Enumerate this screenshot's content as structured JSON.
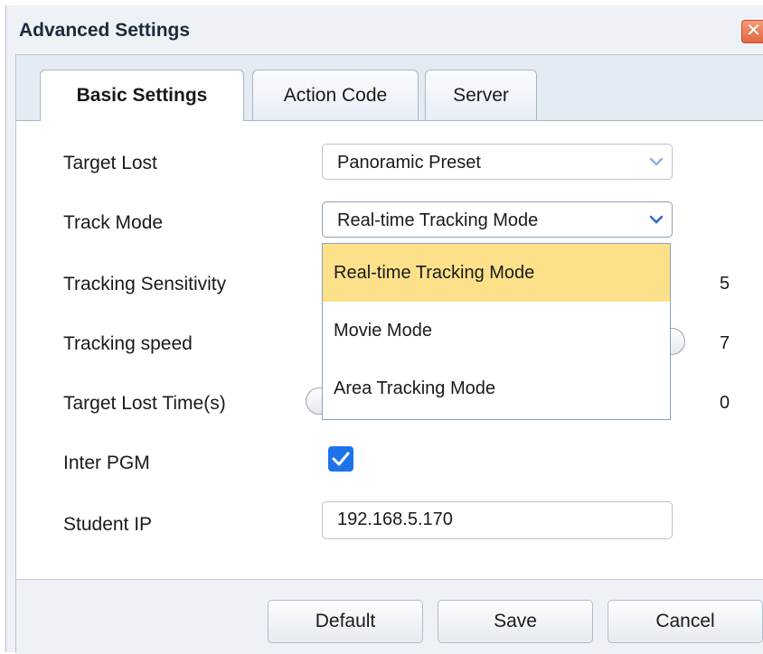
{
  "dialog": {
    "title": "Advanced Settings",
    "close_icon": "close-icon"
  },
  "tabs": [
    {
      "label": "Basic Settings",
      "active": true
    },
    {
      "label": "Action Code",
      "active": false
    },
    {
      "label": "Server",
      "active": false
    }
  ],
  "form": {
    "target_lost": {
      "label": "Target Lost",
      "value": "Panoramic Preset"
    },
    "track_mode": {
      "label": "Track Mode",
      "value": "Real-time Tracking Mode",
      "options": [
        "Real-time Tracking Mode",
        "Movie Mode",
        "Area Tracking Mode"
      ],
      "highlighted": "Real-time Tracking Mode"
    },
    "tracking_sensitivity": {
      "label": "Tracking Sensitivity",
      "value": "5"
    },
    "tracking_speed": {
      "label": "Tracking speed",
      "value": "7"
    },
    "target_lost_time": {
      "label": "Target Lost Time(s)",
      "value": "0"
    },
    "inter_pgm": {
      "label": "Inter PGM",
      "checked": true
    },
    "student_ip": {
      "label": "Student IP",
      "value": "192.168.5.170"
    }
  },
  "footer": {
    "default_label": "Default",
    "save_label": "Save",
    "cancel_label": "Cancel"
  },
  "colors": {
    "accent": "#1f73e8",
    "highlight": "#fde18a",
    "close": "#e0673f"
  }
}
